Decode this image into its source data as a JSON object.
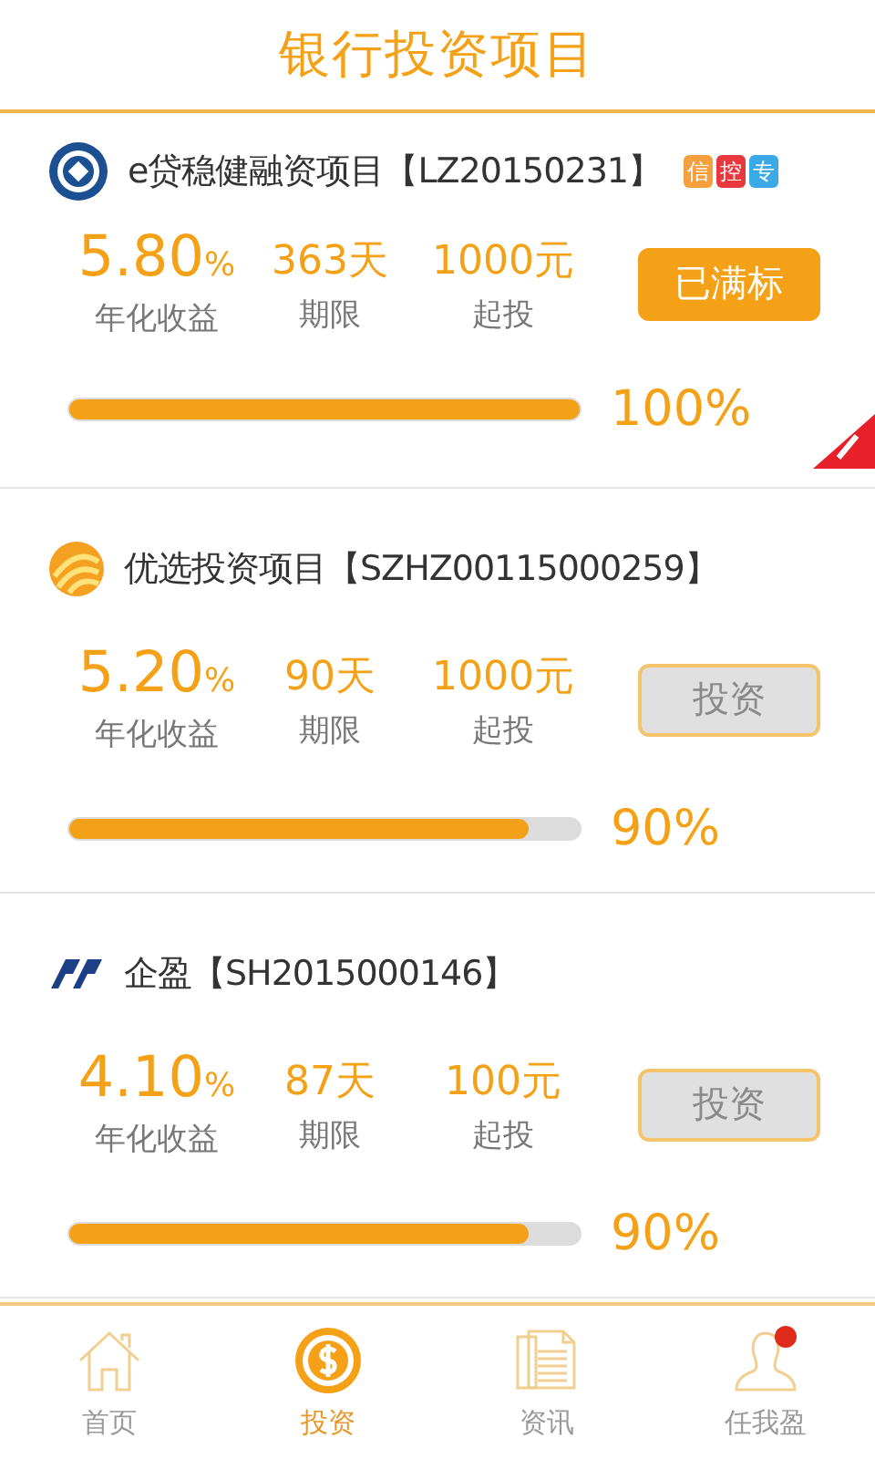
{
  "header": {
    "title": "银行投资项目"
  },
  "projects": [
    {
      "name": "e贷稳健融资项目【LZ20150231】",
      "tags": [
        {
          "label": "信",
          "color": "#f5a03c"
        },
        {
          "label": "控",
          "color": "#e8383d"
        },
        {
          "label": "专",
          "color": "#3ba9e6"
        }
      ],
      "rate": "5.80",
      "rate_unit": "%",
      "rate_label": "年化收益",
      "term": "363天",
      "term_label": "期限",
      "min": "1000元",
      "min_label": "起投",
      "action": {
        "label": "已满标",
        "kind": "full"
      },
      "level": 1.0,
      "percent": "100%",
      "ribbon": true
    },
    {
      "name": "优选投资项目【SZHZ00115000259】",
      "rate": "5.20",
      "rate_unit": "%",
      "rate_label": "年化收益",
      "term": "90天",
      "term_label": "期限",
      "min": "1000元",
      "min_label": "起投",
      "action": {
        "label": "投资",
        "kind": "invest"
      },
      "level": 0.9,
      "percent": "90%",
      "ribbon": false
    },
    {
      "name": "企盈【SH2015000146】",
      "rate": "4.10",
      "rate_unit": "%",
      "rate_label": "年化收益",
      "term": "87天",
      "term_label": "期限",
      "min": "100元",
      "min_label": "起投",
      "action": {
        "label": "投资",
        "kind": "invest"
      },
      "level": 0.9,
      "percent": "90%",
      "ribbon": false
    }
  ],
  "tabs": [
    {
      "label": "首页",
      "selected": false,
      "dot": false
    },
    {
      "label": "投资",
      "selected": true,
      "dot": false
    },
    {
      "label": "资讯",
      "selected": false,
      "dot": false
    },
    {
      "label": "任我盈",
      "selected": false,
      "dot": true
    }
  ]
}
